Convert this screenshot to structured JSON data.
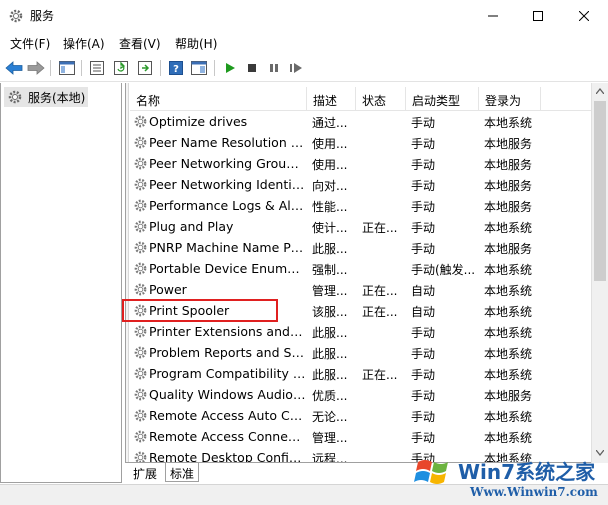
{
  "window": {
    "title": "服务"
  },
  "menu": [
    "文件(F)",
    "操作(A)",
    "查看(V)",
    "帮助(H)"
  ],
  "toolbar_icons": [
    "back-arrow-icon",
    "forward-arrow-icon",
    "console-tree-icon",
    "properties-icon",
    "refresh-icon",
    "export-list-icon",
    "help-icon",
    "show-hide-icon",
    "start-service-icon",
    "stop-service-icon",
    "pause-service-icon",
    "resume-service-icon"
  ],
  "tree": {
    "root_label": "服务(本地)"
  },
  "columns": {
    "name": "名称",
    "desc": "描述",
    "status": "状态",
    "start": "启动类型",
    "logon": "登录为"
  },
  "services": [
    {
      "name": "Optimize drives",
      "desc": "通过...",
      "status": "",
      "start": "手动",
      "logon": "本地系统"
    },
    {
      "name": "Peer Name Resolution Protocol",
      "desc": "使用...",
      "status": "",
      "start": "手动",
      "logon": "本地服务"
    },
    {
      "name": "Peer Networking Grouping",
      "desc": "使用...",
      "status": "",
      "start": "手动",
      "logon": "本地服务"
    },
    {
      "name": "Peer Networking Identity Manager",
      "desc": "向对...",
      "status": "",
      "start": "手动",
      "logon": "本地服务"
    },
    {
      "name": "Performance Logs & Alerts",
      "desc": "性能...",
      "status": "",
      "start": "手动",
      "logon": "本地服务"
    },
    {
      "name": "Plug and Play",
      "desc": "使计...",
      "status": "正在...",
      "start": "手动",
      "logon": "本地系统"
    },
    {
      "name": "PNRP Machine Name Publication",
      "desc": "此服...",
      "status": "",
      "start": "手动",
      "logon": "本地服务"
    },
    {
      "name": "Portable Device Enumerator",
      "desc": "强制...",
      "status": "",
      "start": "手动(触发...",
      "logon": "本地系统"
    },
    {
      "name": "Power",
      "desc": "管理...",
      "status": "正在...",
      "start": "自动",
      "logon": "本地系统"
    },
    {
      "name": "Print Spooler",
      "desc": "该服...",
      "status": "正在...",
      "start": "自动",
      "logon": "本地系统"
    },
    {
      "name": "Printer Extensions and Notifications",
      "desc": "此服...",
      "status": "",
      "start": "手动",
      "logon": "本地系统"
    },
    {
      "name": "Problem Reports and Solutions",
      "desc": "此服...",
      "status": "",
      "start": "手动",
      "logon": "本地系统"
    },
    {
      "name": "Program Compatibility Assistant",
      "desc": "此服...",
      "status": "正在...",
      "start": "手动",
      "logon": "本地系统"
    },
    {
      "name": "Quality Windows Audio Video",
      "desc": "优质...",
      "status": "",
      "start": "手动",
      "logon": "本地服务"
    },
    {
      "name": "Remote Access Auto Connection",
      "desc": "无论...",
      "status": "",
      "start": "手动",
      "logon": "本地系统"
    },
    {
      "name": "Remote Access Connection",
      "desc": "管理...",
      "status": "",
      "start": "手动",
      "logon": "本地系统"
    },
    {
      "name": "Remote Desktop Configuration",
      "desc": "远程...",
      "status": "",
      "start": "手动",
      "logon": "本地系统"
    }
  ],
  "tabs": [
    "扩展",
    "标准"
  ],
  "watermark": {
    "brand": "Win7系统之家",
    "url": "Www.Winwin7.com"
  },
  "colors": {
    "highlight_border": "#e02020",
    "watermark_blue": "#1f5ea8"
  }
}
